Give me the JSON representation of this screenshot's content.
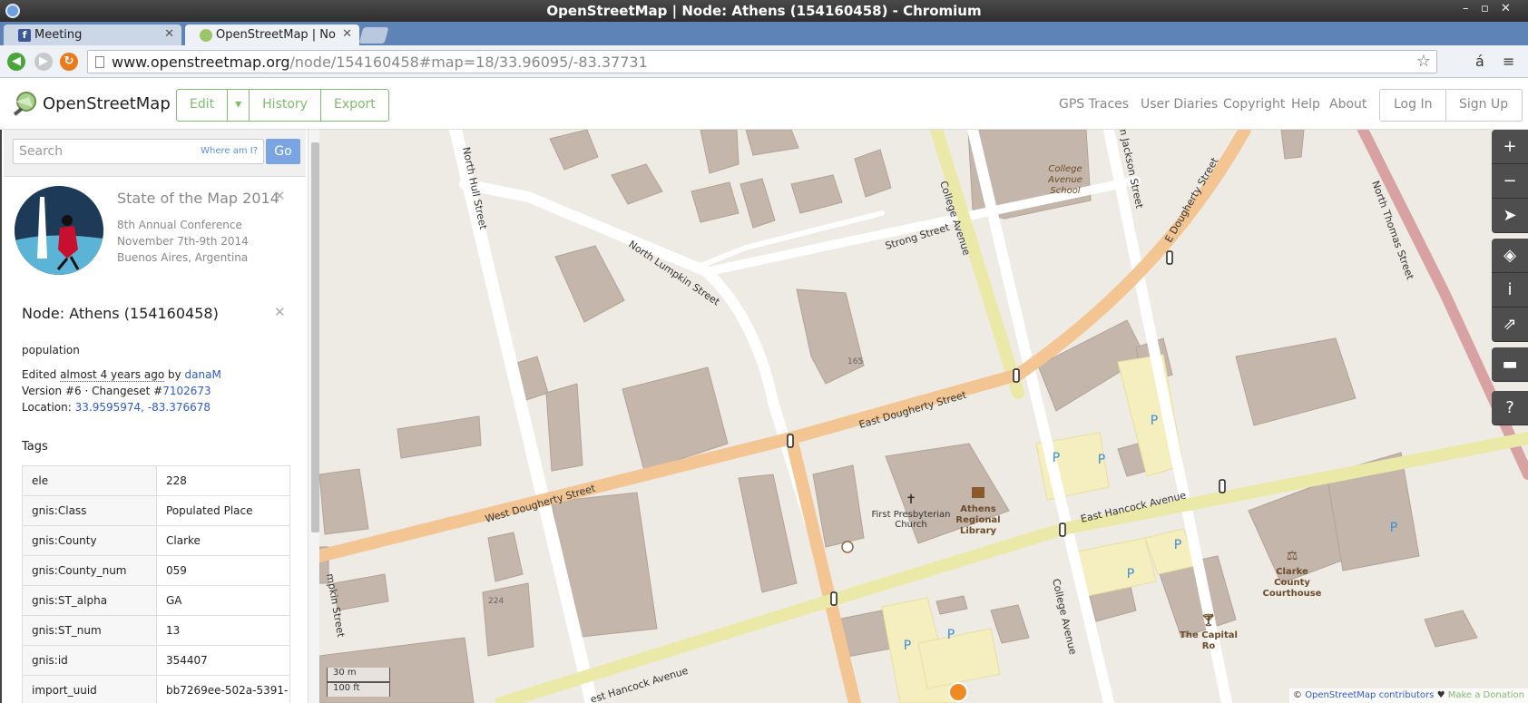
{
  "window": {
    "title": "OpenStreetMap | Node: Athens (154160458) - Chromium"
  },
  "tabs": [
    {
      "label": "Meeting"
    },
    {
      "label": "OpenStreetMap | No"
    }
  ],
  "address": {
    "host": "www.openstreetmap.org",
    "path": "/node/154160458#map=18/33.96095/-83.37731"
  },
  "header": {
    "brand": "OpenStreetMap",
    "edit": "Edit",
    "history": "History",
    "export": "Export",
    "nav": [
      "GPS Traces",
      "User Diaries",
      "Copyright",
      "Help",
      "About"
    ],
    "login": "Log In",
    "signup": "Sign Up"
  },
  "search": {
    "placeholder": "Search",
    "where": "Where am I?",
    "go": "Go"
  },
  "banner": {
    "title": "State of the Map 2014",
    "line1": "8th Annual Conference",
    "line2": "November 7th-9th 2014",
    "line3": "Buenos Aires, Argentina"
  },
  "node": {
    "title": "Node: Athens (154160458)",
    "name_label": "population",
    "edited_prefix": "Edited",
    "edited_ago": "almost 4 years ago",
    "edited_by": "by",
    "user": "danaM",
    "version_text": "Version #6 · Changeset #",
    "changeset": "7102673",
    "location_label": "Location:",
    "location": "33.9595974, -83.376678"
  },
  "tags": {
    "header": "Tags",
    "rows": [
      {
        "k": "ele",
        "v": "228"
      },
      {
        "k": "gnis:Class",
        "v": "Populated Place"
      },
      {
        "k": "gnis:County",
        "v": "Clarke"
      },
      {
        "k": "gnis:County_num",
        "v": "059"
      },
      {
        "k": "gnis:ST_alpha",
        "v": "GA"
      },
      {
        "k": "gnis:ST_num",
        "v": "13"
      },
      {
        "k": "gnis:id",
        "v": "354407"
      },
      {
        "k": "import_uuid",
        "v": "bb7269ee-502a-5391-"
      }
    ]
  },
  "map": {
    "streets": {
      "north_hull": "North Hull Street",
      "north_lumpkin": "North Lumpkin Street",
      "strong": "Strong Street",
      "college_avenue_north": "College Avenue",
      "jackson": "n Jackson Street",
      "e_dougherty": "E Dougherty Street",
      "north_thomas": "North Thomas Street",
      "east_dougherty": "East Dougherty Street",
      "west_dougherty": "West Dougherty Street",
      "east_hancock": "East Hancock Avenue",
      "college_avenue_south": "College Avenue",
      "hancock_sw": "est Hancock Avenue",
      "lumpkin_sw": "mpkin Street"
    },
    "pois": {
      "school_l1": "College",
      "school_l2": "Avenue",
      "school_l3": "School",
      "church_l1": "First Presbyterian",
      "church_l2": "Church",
      "library_l1": "Athens",
      "library_l2": "Regional",
      "library_l3": "Library",
      "courthouse_l1": "Clarke",
      "courthouse_l2": "County",
      "courthouse_l3": "Courthouse",
      "capital_l1": "The Capital",
      "capital_l2": "Ro"
    },
    "housenumbers": {
      "n165": "165",
      "n224": "224"
    },
    "parking": "P",
    "scale": {
      "metric": "30 m",
      "imperial": "100 ft"
    },
    "attribution": {
      "copy": "©",
      "osm": "OpenStreetMap contributors",
      "heart": "♥",
      "donate": "Make a Donation"
    },
    "controls": [
      "zoom-in",
      "zoom-out",
      "locate",
      "layers",
      "info",
      "share",
      "note",
      "help"
    ]
  }
}
